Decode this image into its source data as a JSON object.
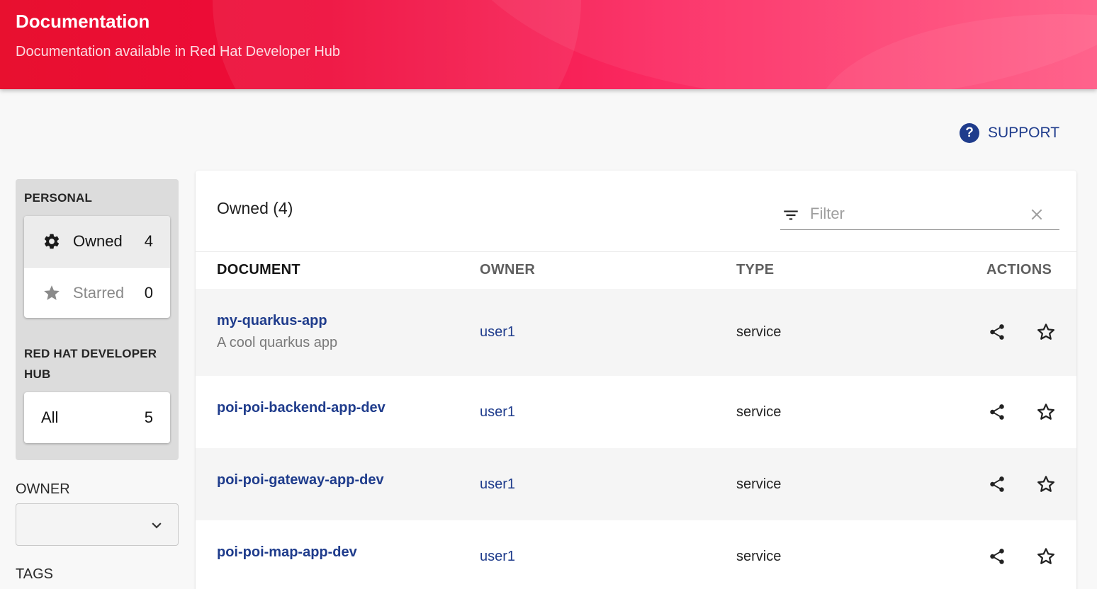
{
  "header": {
    "title": "Documentation",
    "subtitle": "Documentation available in Red Hat Developer Hub"
  },
  "support": {
    "label": "SUPPORT",
    "icon": "help-circle-icon"
  },
  "sidebar": {
    "personal_heading": "PERSONAL",
    "personal_items": [
      {
        "label": "Owned",
        "count": "4",
        "icon": "gear-icon",
        "selected": true
      },
      {
        "label": "Starred",
        "count": "0",
        "icon": "star-icon",
        "selected": false
      }
    ],
    "org_heading": "RED HAT DEVELOPER HUB",
    "org_items": [
      {
        "label": "All",
        "count": "5"
      }
    ],
    "owner_label": "OWNER",
    "owner_value": "",
    "tags_label": "TAGS"
  },
  "main": {
    "title": "Owned (4)",
    "filter_placeholder": "Filter",
    "columns": [
      "DOCUMENT",
      "OWNER",
      "TYPE",
      "ACTIONS"
    ],
    "rows": [
      {
        "name": "my-quarkus-app",
        "description": "A cool quarkus app",
        "owner": "user1",
        "type": "service"
      },
      {
        "name": "poi-poi-backend-app-dev",
        "description": "",
        "owner": "user1",
        "type": "service"
      },
      {
        "name": "poi-poi-gateway-app-dev",
        "description": "",
        "owner": "user1",
        "type": "service"
      },
      {
        "name": "poi-poi-map-app-dev",
        "description": "",
        "owner": "user1",
        "type": "service"
      }
    ]
  },
  "colors": {
    "brand_red": "#ee0a3a",
    "link_blue": "#1f3c8c"
  }
}
